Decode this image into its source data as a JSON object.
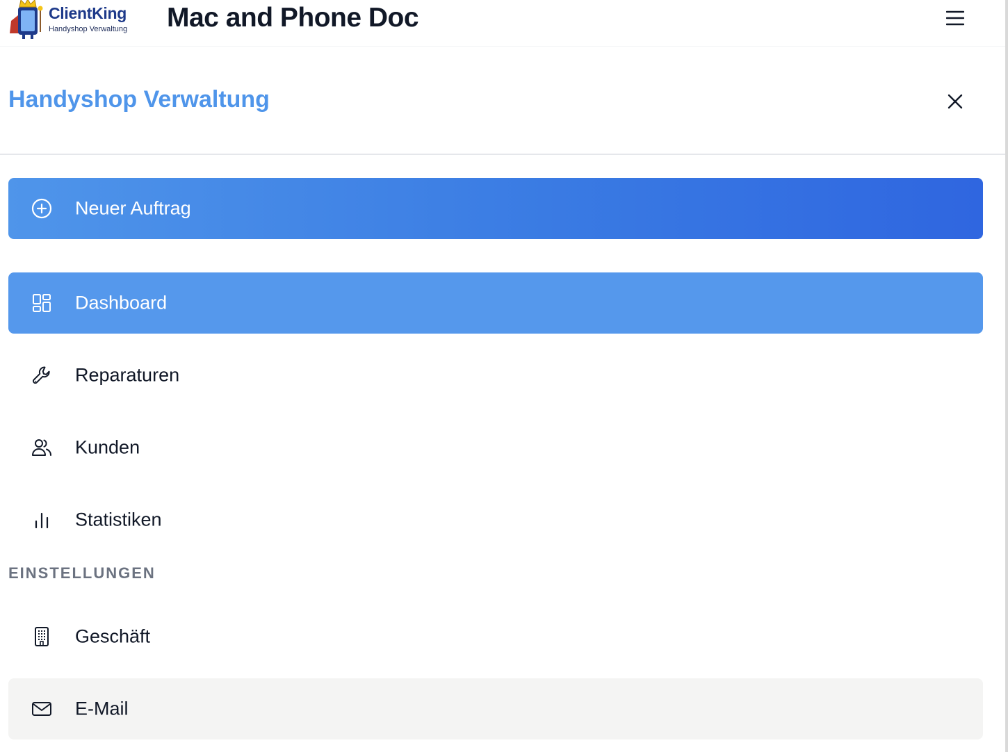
{
  "header": {
    "logo_name": "ClientKing",
    "logo_tagline": "Handyshop Verwaltung",
    "shop_name": "Mac and Phone Doc",
    "menu_icon": "hamburger-menu-icon"
  },
  "sidebar": {
    "title": "Handyshop Verwaltung",
    "close_icon": "close-icon",
    "new_order": {
      "label": "Neuer Auftrag",
      "icon": "plus-circle-icon"
    },
    "items": [
      {
        "label": "Dashboard",
        "icon": "dashboard-grid-icon",
        "active": true
      },
      {
        "label": "Reparaturen",
        "icon": "wrench-icon",
        "active": false
      },
      {
        "label": "Kunden",
        "icon": "users-icon",
        "active": false
      },
      {
        "label": "Statistiken",
        "icon": "bar-chart-icon",
        "active": false
      }
    ],
    "settings_section_label": "EINSTELLUNGEN",
    "settings_items": [
      {
        "label": "Geschäft",
        "icon": "building-icon"
      },
      {
        "label": "E-Mail",
        "icon": "mail-icon",
        "highlighted": true
      }
    ]
  },
  "colors": {
    "accent": "#4f95ea",
    "gradient_start": "#4f95ea",
    "gradient_end": "#2f66e0",
    "active_bg": "#5598ec",
    "hover_bg": "#f4f4f3",
    "text": "#111827",
    "section_label": "#6b7280"
  }
}
